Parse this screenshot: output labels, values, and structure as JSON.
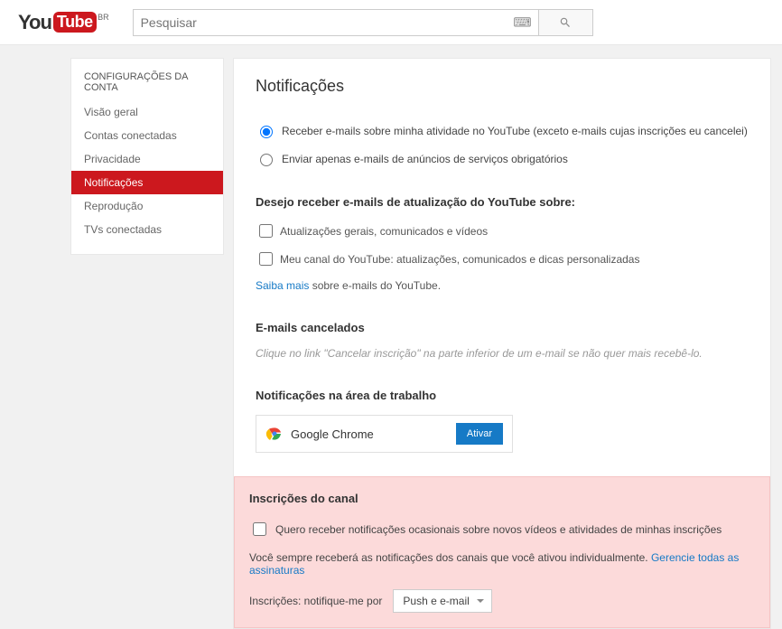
{
  "header": {
    "logo_you": "You",
    "logo_tube": "Tube",
    "logo_region": "BR",
    "search_placeholder": "Pesquisar"
  },
  "sidebar": {
    "title": "CONFIGURAÇÕES DA CONTA",
    "items": [
      {
        "label": "Visão geral",
        "active": false
      },
      {
        "label": "Contas conectadas",
        "active": false
      },
      {
        "label": "Privacidade",
        "active": false
      },
      {
        "label": "Notificações",
        "active": true
      },
      {
        "label": "Reprodução",
        "active": false
      },
      {
        "label": "TVs conectadas",
        "active": false
      }
    ]
  },
  "main": {
    "title": "Notificações",
    "radio1": "Receber e-mails sobre minha atividade no YouTube (exceto e-mails cujas inscrições eu cancelei)",
    "radio2": "Enviar apenas e-mails de anúncios de serviços obrigatórios",
    "updates_heading": "Desejo receber e-mails de atualização do YouTube sobre:",
    "check1": "Atualizações gerais, comunicados e vídeos",
    "check2": "Meu canal do YouTube: atualizações, comunicados e dicas personalizadas",
    "learn_more_link": "Saiba mais",
    "learn_more_rest": " sobre e-mails do YouTube.",
    "cancelled_heading": "E-mails cancelados",
    "cancelled_hint": "Clique no link \"Cancelar inscrição\" na parte inferior de um e-mail se não quer mais recebê-lo.",
    "desktop_heading": "Notificações na área de trabalho",
    "chrome_label": "Google Chrome",
    "activate_label": "Ativar",
    "subs_heading": "Inscrições do canal",
    "subs_check": "Quero receber notificações ocasionais sobre novos vídeos e atividades de minhas inscrições",
    "subs_text": "Você sempre receberá as notificações dos canais que você ativou individualmente. ",
    "subs_link": "Gerencie todas as assinaturas",
    "notify_label": "Inscrições: notifique-me por",
    "notify_value": "Push e e-mail"
  }
}
